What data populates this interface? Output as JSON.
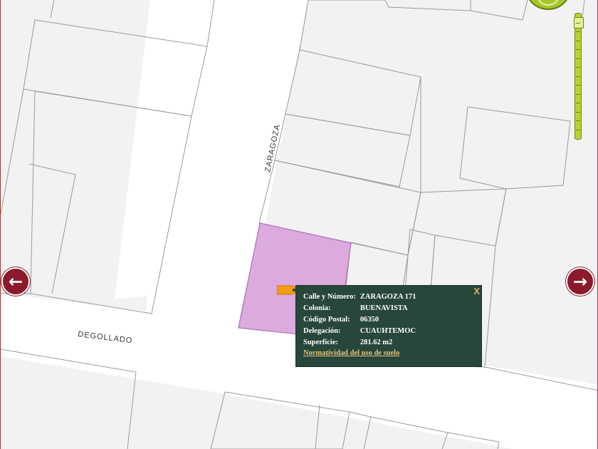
{
  "map": {
    "street_labels": {
      "zaragoza": "ZARAGOZA",
      "degollado": "DEGOLLADO"
    },
    "colors": {
      "background": "#f2f2f2",
      "streets": "#ffffff",
      "lot_outline": "#9a9a9a",
      "selected_lot": "#dcaadc",
      "selected_outline": "#b070c0",
      "popup_bg": "#27473b",
      "arrow_bg": "#8b1a2b",
      "zoom_green": "#b5d334",
      "pin": "#f39c12"
    },
    "navigation": {
      "left_icon": "arrow-left-icon",
      "right_icon": "arrow-right-icon"
    },
    "zoom": {
      "level_fraction": 0.97
    }
  },
  "popup": {
    "close_label": "X",
    "rows": [
      {
        "label": "Calle y Número:",
        "value": "ZARAGOZA 171"
      },
      {
        "label": "Colonia:",
        "value": "BUENAVISTA"
      },
      {
        "label": "Código Postal:",
        "value": "06350"
      },
      {
        "label": "Delegación:",
        "value": "CUAUHTEMOC"
      },
      {
        "label": "Superficie:",
        "value": "281.62 m2"
      }
    ],
    "link_text": "Normatividad del uso de suelo"
  }
}
